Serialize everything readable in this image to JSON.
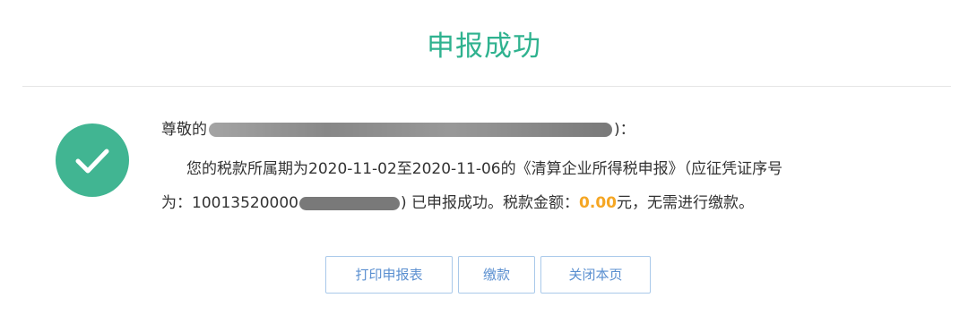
{
  "title": "申报成功",
  "message": {
    "greeting_prefix": "尊敬的",
    "greeting_suffix": ")：",
    "line2": "您的税款所属期为2020-11-02至2020-11-06的《清算企业所得税申报》（应征凭证序号",
    "line3_prefix": "为：10013520000",
    "line3_middle": ") 已申报成功。税款金额：",
    "amount": "0.00",
    "line3_suffix": "元，无需进行缴款。"
  },
  "buttons": {
    "print": "打印申报表",
    "pay": "缴款",
    "close": "关闭本页"
  },
  "colors": {
    "title": "#2fb28f",
    "success_icon": "#41b592",
    "amount": "#f5a623",
    "button_text": "#5a8fd0",
    "button_border": "#a9c9ea"
  },
  "icons": {
    "success": "check-circle-icon"
  }
}
